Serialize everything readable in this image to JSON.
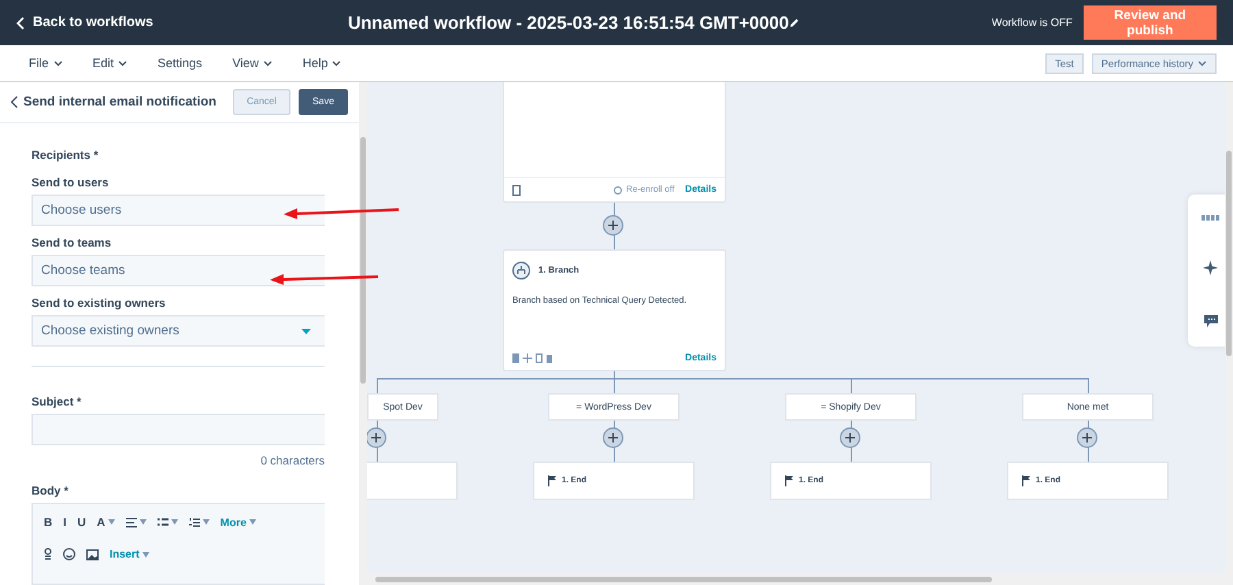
{
  "topbar": {
    "back_link": "Back to workflows",
    "title": "Unnamed workflow - 2025-03-23 16:51:54 GMT+0000",
    "status": "Workflow is OFF",
    "publish_button": "Review and publish"
  },
  "menu": {
    "items": [
      {
        "label": "File",
        "dropdown": true
      },
      {
        "label": "Edit",
        "dropdown": true
      },
      {
        "label": "Settings",
        "dropdown": false
      },
      {
        "label": "View",
        "dropdown": true
      },
      {
        "label": "Help",
        "dropdown": true
      }
    ],
    "test_button": "Test",
    "performance_button": "Performance history"
  },
  "panel": {
    "title": "Send internal email notification",
    "cancel_button": "Cancel",
    "save_button": "Save",
    "recipients_label": "Recipients *",
    "fields": [
      {
        "label": "Send to users",
        "placeholder": "Choose users",
        "kind": "combo"
      },
      {
        "label": "Send to teams",
        "placeholder": "Choose teams",
        "kind": "combo"
      },
      {
        "label": "Send to existing owners",
        "placeholder": "Choose existing owners",
        "kind": "select"
      }
    ],
    "subject_label": "Subject *",
    "char_count": "0 characters",
    "body_label": "Body *",
    "toolbar": {
      "row_1": [
        {
          "kind": "letter",
          "text": "B"
        },
        {
          "kind": "letter",
          "text": "I"
        },
        {
          "kind": "letter",
          "text": "U"
        },
        {
          "kind": "letter",
          "text": "A",
          "caret": true
        },
        {
          "kind": "align",
          "caret": true
        },
        {
          "kind": "bullets",
          "caret": true
        },
        {
          "kind": "numbers",
          "caret": true
        },
        {
          "kind": "menu",
          "text": "More"
        }
      ],
      "row_2": [
        {
          "kind": "token"
        },
        {
          "kind": "emoji"
        },
        {
          "kind": "image"
        },
        {
          "kind": "menu",
          "text": "Insert"
        }
      ]
    }
  },
  "canvas": {
    "top_card": {
      "reenroll": "Re-enroll off",
      "link": "Details"
    },
    "branch_card": {
      "title": "1. Branch",
      "description": "Branch based on Technical Query Detected.",
      "link": "Details"
    },
    "branches": [
      {
        "label": "Spot Dev"
      },
      {
        "label": "= WordPress Dev",
        "end": "1. End"
      },
      {
        "label": "= Shopify Dev",
        "end": "1. End"
      },
      {
        "label": "None met",
        "end": "1. End"
      }
    ]
  }
}
